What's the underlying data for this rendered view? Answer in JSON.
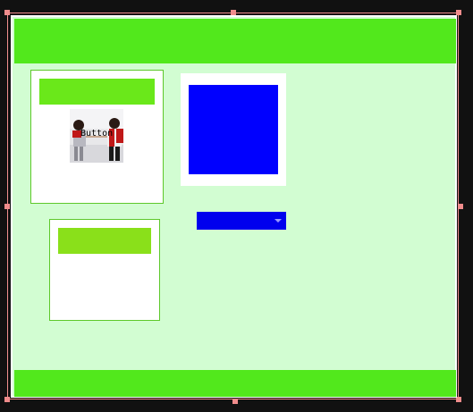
{
  "colors": {
    "page_background": "#d2fdd2",
    "header": "#52e81c",
    "footer": "#52e81c",
    "panel_bar_primary": "#6ae81a",
    "panel_bar_secondary": "#8ae01a",
    "media_block": "#0000ff",
    "select_background": "#0000ee",
    "selection_outline": "#f08c8c"
  },
  "image_button": {
    "label": "Button",
    "image": "couple-photo"
  },
  "select": {
    "value": ""
  }
}
